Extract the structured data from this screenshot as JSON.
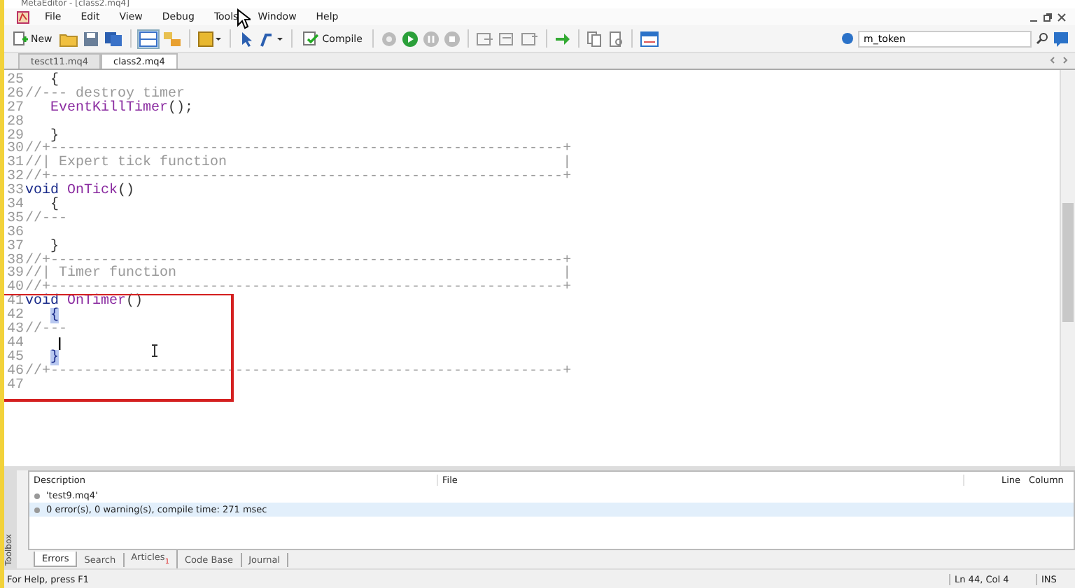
{
  "window": {
    "title": "MetaEditor - [class2.mq4]"
  },
  "menu": [
    "File",
    "Edit",
    "View",
    "Debug",
    "Tools",
    "Window",
    "Help"
  ],
  "toolbar": {
    "new_label": "New",
    "compile_label": "Compile",
    "search": {
      "value": "m_token"
    }
  },
  "tabs": [
    {
      "label": "tesct11.mq4",
      "selected": false
    },
    {
      "label": "class2.mq4",
      "selected": true
    }
  ],
  "code_lines": [
    {
      "number": "25",
      "segments": [
        {
          "kind": "plain",
          "text": "   {"
        }
      ]
    },
    {
      "number": "26",
      "segments": [
        {
          "kind": "comment",
          "text": "//--- destroy timer"
        }
      ]
    },
    {
      "number": "27",
      "segments": [
        {
          "kind": "function",
          "text": "   EventKillTimer"
        },
        {
          "kind": "plain",
          "text": "();"
        }
      ]
    },
    {
      "number": "28"
    },
    {
      "number": "29",
      "segments": [
        {
          "kind": "plain",
          "text": "   }"
        }
      ]
    },
    {
      "number": "30",
      "segments": [
        {
          "kind": "comment",
          "text": "//+-------------------------------------------------------------+"
        }
      ]
    },
    {
      "number": "31",
      "segments": [
        {
          "kind": "comment",
          "text": "//| Expert tick function                                        |"
        }
      ]
    },
    {
      "number": "32",
      "segments": [
        {
          "kind": "comment",
          "text": "//+-------------------------------------------------------------+"
        }
      ]
    },
    {
      "number": "33",
      "segments": [
        {
          "kind": "keyword",
          "text": "void "
        },
        {
          "kind": "function",
          "text": "OnTick"
        },
        {
          "kind": "plain",
          "text": "()"
        }
      ]
    },
    {
      "number": "34",
      "segments": [
        {
          "kind": "plain",
          "text": "   {"
        }
      ]
    },
    {
      "number": "35",
      "segments": [
        {
          "kind": "comment",
          "text": "//---"
        }
      ]
    },
    {
      "number": "36"
    },
    {
      "number": "37",
      "segments": [
        {
          "kind": "plain",
          "text": "   }"
        }
      ]
    },
    {
      "number": "38",
      "segments": [
        {
          "kind": "comment",
          "text": "//+-------------------------------------------------------------+"
        }
      ]
    },
    {
      "number": "39",
      "segments": [
        {
          "kind": "comment",
          "text": "//| Timer function                                              |"
        }
      ]
    },
    {
      "number": "40",
      "segments": [
        {
          "kind": "comment",
          "text": "//+-------------------------------------------------------------+"
        }
      ]
    },
    {
      "number": "41",
      "segments": [
        {
          "kind": "keyword",
          "text": "void "
        },
        {
          "kind": "function",
          "text": "OnTimer"
        },
        {
          "kind": "plain",
          "text": "()"
        }
      ]
    },
    {
      "number": "42",
      "segments": [
        {
          "kind": "brace-match",
          "text": "{"
        }
      ]
    },
    {
      "number": "43",
      "segments": [
        {
          "kind": "comment",
          "text": "//---"
        }
      ]
    },
    {
      "number": "44",
      "segments": [
        {
          "kind": "caret"
        }
      ]
    },
    {
      "number": "45",
      "segments": [
        {
          "kind": "brace-match",
          "text": "}"
        }
      ]
    },
    {
      "number": "46",
      "segments": [
        {
          "kind": "comment",
          "text": "//+-------------------------------------------------------------+"
        }
      ]
    },
    {
      "number": "47"
    }
  ],
  "toolbox": {
    "title": "Toolbox",
    "columns": [
      "Description",
      "File",
      "Line",
      "Column"
    ],
    "rows": [
      {
        "description": "'test9.mq4'",
        "selected": false
      },
      {
        "description": "0 error(s), 0 warning(s), compile time: 271 msec",
        "selected": true
      }
    ],
    "tabs": [
      {
        "label": "Errors",
        "selected": true
      },
      {
        "label": "Search",
        "selected": false
      },
      {
        "label": "Articles",
        "badge": "1",
        "selected": false
      },
      {
        "label": "Code Base",
        "selected": false
      },
      {
        "label": "Journal",
        "selected": false
      }
    ]
  },
  "status_bar": {
    "help": "For Help, press F1",
    "position": "Ln 44, Col 4",
    "mode": "INS"
  }
}
